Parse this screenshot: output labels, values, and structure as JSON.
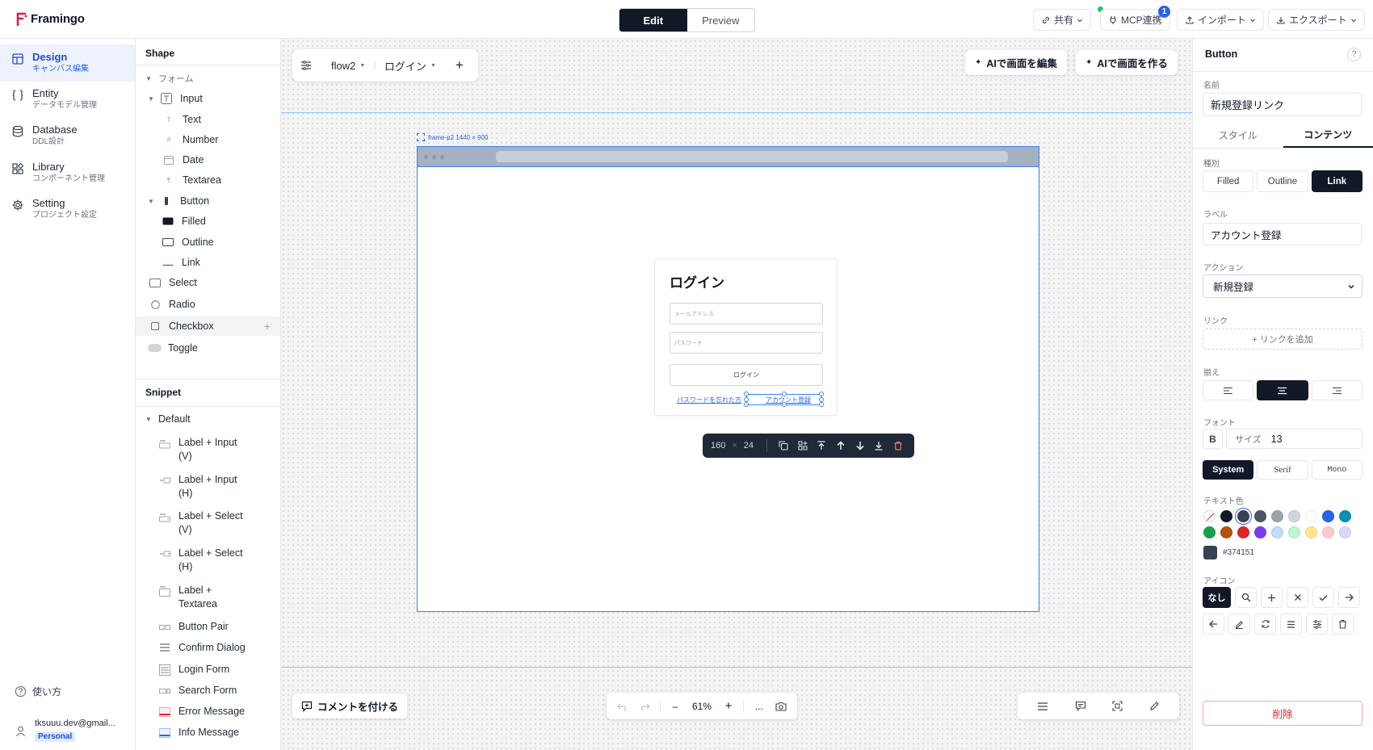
{
  "app": {
    "name": "Framingo",
    "brand_color": "#e11d48"
  },
  "header": {
    "mode_edit": "Edit",
    "mode_preview": "Preview",
    "share_label": "共有",
    "mcp_label": "MCP連携",
    "mcp_badge": "1",
    "import_label": "インポート",
    "export_label": "エクスポート"
  },
  "leftnav": {
    "items": [
      {
        "title": "Design",
        "sub": "キャンバス編集",
        "icon": "layout-icon"
      },
      {
        "title": "Entity",
        "sub": "データモデル管理",
        "icon": "braces-icon"
      },
      {
        "title": "Database",
        "sub": "DDL設計",
        "icon": "database-icon"
      },
      {
        "title": "Library",
        "sub": "コンポーネント管理",
        "icon": "library-icon"
      },
      {
        "title": "Setting",
        "sub": "プロジェクト設定",
        "icon": "gear-icon"
      }
    ],
    "help": "使い方",
    "user_email": "tksuuu.dev@gmail...",
    "user_plan": "Personal"
  },
  "shapes": {
    "heading": "Shape",
    "group_form": "フォーム",
    "input": "Input",
    "text": "Text",
    "number": "Number",
    "date": "Date",
    "textarea": "Textarea",
    "button": "Button",
    "filled": "Filled",
    "outline": "Outline",
    "link": "Link",
    "select": "Select",
    "radio": "Radio",
    "checkbox": "Checkbox",
    "toggle": "Toggle"
  },
  "snippets": {
    "heading": "Snippet",
    "group": "Default",
    "items": [
      {
        "l1": "Label + Input",
        "l2": "(V)"
      },
      {
        "l1": "Label + Input",
        "l2": "(H)"
      },
      {
        "l1": "Label + Select",
        "l2": "(V)"
      },
      {
        "l1": "Label + Select",
        "l2": "(H)"
      },
      {
        "l1": "Label +",
        "l2": "Textarea"
      },
      {
        "l1": "Button Pair",
        "l2": ""
      },
      {
        "l1": "Confirm Dialog",
        "l2": ""
      },
      {
        "l1": "Login Form",
        "l2": ""
      },
      {
        "l1": "Search Form",
        "l2": ""
      },
      {
        "l1": "Error Message",
        "l2": ""
      },
      {
        "l1": "Info Message",
        "l2": ""
      }
    ]
  },
  "canvas": {
    "flow_name": "flow2",
    "screen_name": "ログイン",
    "ai_edit": "AIで画面を編集",
    "ai_create": "AIで画面を作る",
    "frame_label": "frame-p2  1440 × 900",
    "login": {
      "title": "ログイン",
      "email_placeholder": "メールアドレス",
      "password_placeholder": "パスワード",
      "submit": "ログイン",
      "forgot": "パスワードを忘れた方",
      "register": "アカウント登録"
    },
    "toolbar": {
      "width": "160",
      "times": "×",
      "height": "24"
    },
    "comment": "コメントを付ける",
    "zoom": "61%",
    "more": "..."
  },
  "props": {
    "title": "Button",
    "help": "?",
    "name_label": "名前",
    "name_value": "新規登録リンク",
    "tab_style": "スタイル",
    "tab_content": "コンテンツ",
    "kind_label": "種別",
    "kinds": [
      "Filled",
      "Outline",
      "Link"
    ],
    "label_label": "ラベル",
    "label_value": "アカウント登録",
    "action_label": "アクション",
    "action_value": "新規登録",
    "link_label": "リンク",
    "add_link": "+ リンクを追加",
    "align_label": "揃え",
    "font_label": "フォント",
    "bold": "B",
    "size_label": "サイズ",
    "size_value": "13",
    "families": [
      "System",
      "Serif",
      "Mono"
    ],
    "text_color_label": "テキスト色",
    "colors_row1": [
      "#111827",
      "#374151",
      "#4b5563",
      "#9ca3af",
      "#d1d5db",
      "#ffffff",
      "#2563eb",
      "#0891b2"
    ],
    "colors_row2": [
      "#16a34a",
      "#b45309",
      "#dc2626",
      "#7c3aed",
      "#bfdbfe",
      "#bbf7d0",
      "#fde68a",
      "#fecaca",
      "#ddd6fe"
    ],
    "current_color": "#374151",
    "icon_label": "アイコン",
    "icon_none": "なし",
    "delete": "削除"
  }
}
